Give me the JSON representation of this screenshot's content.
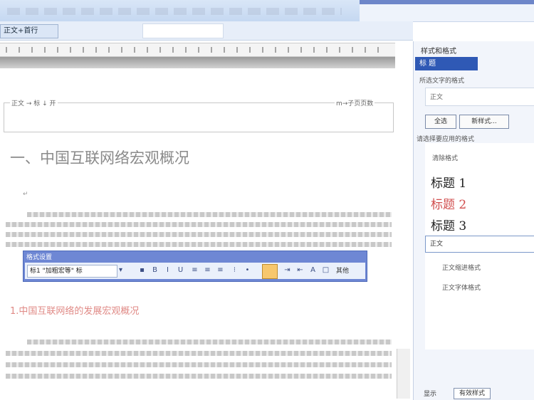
{
  "toolbar": {
    "style_combo": "正文+首行",
    "font_combo": ""
  },
  "document": {
    "header_left": "正文 → 标 ↓ 开",
    "header_right": "m→子页页数",
    "heading1": "一、中国互联网络宏观概况",
    "marker": "↵",
    "heading2": "1.中国互联网络的发展宏观概况"
  },
  "format_toolbar": {
    "title": "格式设置",
    "style_value": "标1 \"加粗宏等\" 标",
    "right_label": "其他"
  },
  "task_pane": {
    "title": "样式和格式",
    "selected": "标 题",
    "formatting_label": "所选文字的格式",
    "current_format": "正文",
    "select_all_button": "全选",
    "new_style_button": "新样式...",
    "pick_label": "请选择要应用的格式",
    "list_first": "清除格式",
    "style_h1": "标题 1",
    "style_h2": "标题 2",
    "style_h3": "标题 3",
    "selected_item": "正文",
    "option1": "正文缩进格式",
    "option2": "正文字体格式",
    "footer_label": "显示",
    "footer_value": "有效样式"
  },
  "colors": {
    "title_bar": "#c5d8f1",
    "pane_select": "#2f59b5",
    "heading2_text": "#e08a86",
    "float_toolbar": "#6e87d4",
    "highlight_button": "#f7c76d"
  }
}
